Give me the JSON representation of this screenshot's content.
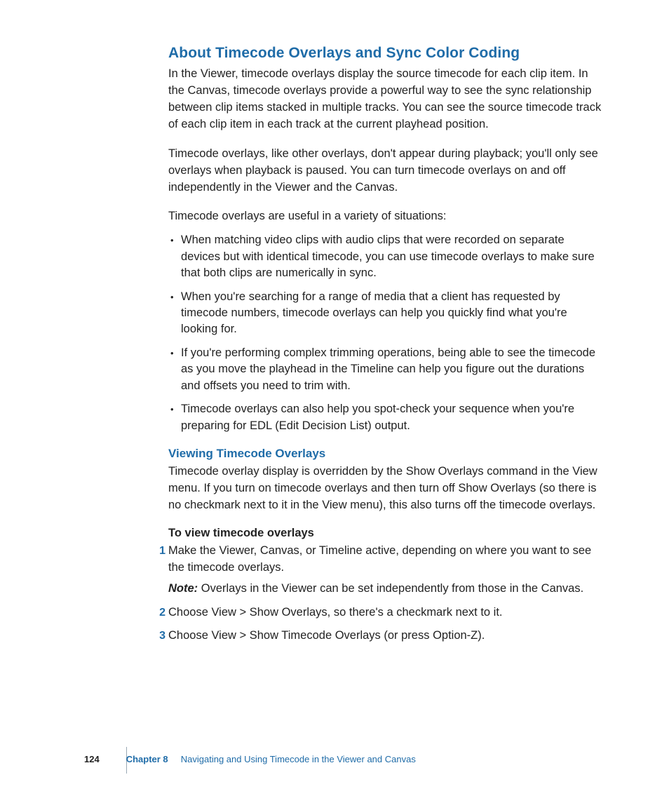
{
  "h1": "About Timecode Overlays and Sync Color Coding",
  "p1": "In the Viewer, timecode overlays display the source timecode for each clip item. In the Canvas, timecode overlays provide a powerful way to see the sync relationship between clip items stacked in multiple tracks. You can see the source timecode track of each clip item in each track at the current playhead position.",
  "p2": "Timecode overlays, like other overlays, don't appear during playback; you'll only see overlays when playback is paused. You can turn timecode overlays on and off independently in the Viewer and the Canvas.",
  "p3": "Timecode overlays are useful in a variety of situations:",
  "bullets": [
    "When matching video clips with audio clips that were recorded on separate devices but with identical timecode, you can use timecode overlays to make sure that both clips are numerically in sync.",
    "When you're searching for a range of media that a client has requested by timecode numbers, timecode overlays can help you quickly find what you're looking for.",
    "If you're performing complex trimming operations, being able to see the timecode as you move the playhead in the Timeline can help you figure out the durations and offsets you need to trim with.",
    "Timecode overlays can also help you spot-check your sequence when you're preparing for EDL (Edit Decision List) output."
  ],
  "h2": "Viewing Timecode Overlays",
  "p4": "Timecode overlay display is overridden by the Show Overlays command in the View menu. If you turn on timecode overlays and then turn off Show Overlays (so there is no checkmark next to it in the View menu), this also turns off the timecode overlays.",
  "sub": "To view timecode overlays",
  "steps": [
    "Make the Viewer, Canvas, or Timeline active, depending on where you want to see the timecode overlays.",
    "Choose View > Show Overlays, so there's a checkmark next to it.",
    "Choose View > Show Timecode Overlays (or press Option-Z)."
  ],
  "step_nums": [
    "1",
    "2",
    "3"
  ],
  "note_label": "Note:",
  "note_text": "Overlays in the Viewer can be set independently from those in the Canvas.",
  "footer": {
    "page": "124",
    "chapter": "Chapter 8",
    "title": "Navigating and Using Timecode in the Viewer and Canvas"
  }
}
